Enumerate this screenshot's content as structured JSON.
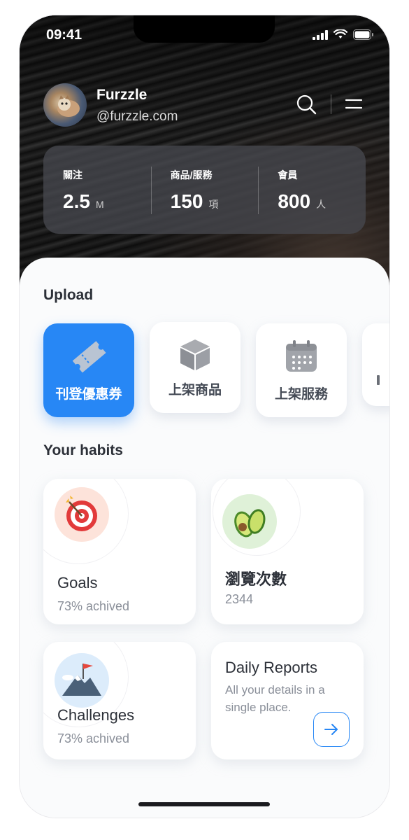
{
  "status": {
    "time": "09:41"
  },
  "profile": {
    "name": "Furzzle",
    "handle": "@furzzle.com"
  },
  "stats": [
    {
      "label": "關注",
      "value": "2.5",
      "unit": "M"
    },
    {
      "label": "商品/服務",
      "value": "150",
      "unit": "項"
    },
    {
      "label": "會員",
      "value": "800",
      "unit": "人"
    }
  ],
  "upload": {
    "title": "Upload",
    "items": [
      {
        "label": "刊登優惠券",
        "icon": "ticket-icon",
        "active": true
      },
      {
        "label": "上架商品",
        "icon": "box-icon",
        "active": false
      },
      {
        "label": "上架服務",
        "icon": "calendar-icon",
        "active": false
      }
    ]
  },
  "habits": {
    "title": "Your habits",
    "goals": {
      "title": "Goals",
      "sub": "73% achived",
      "icon": "target-icon"
    },
    "views": {
      "title": "瀏覽次數",
      "sub": "2344",
      "icon": "avocado-icon"
    },
    "challenges": {
      "title": "Challenges",
      "sub": "73% achived",
      "icon": "mountain-flag-icon"
    },
    "reports": {
      "title": "Daily Reports",
      "desc": "All your details in a single place.",
      "icon": "arrow-right-icon"
    }
  },
  "colors": {
    "accent": "#2787f5",
    "text_dark": "#2c3038",
    "text_muted": "#8a8f99"
  }
}
